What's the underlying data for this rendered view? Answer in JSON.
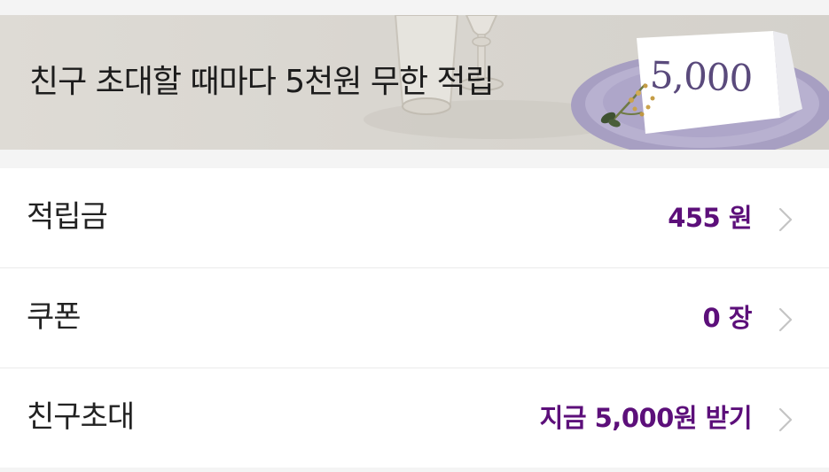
{
  "banner": {
    "title": "친구 초대할 때마다 5천원 무한 적립",
    "card_amount": "5,000"
  },
  "menu": {
    "items": [
      {
        "label": "적립금",
        "value": "455 원",
        "icon": "chevron-right-icon"
      },
      {
        "label": "쿠폰",
        "value": "0 장",
        "icon": "chevron-right-icon"
      },
      {
        "label": "친구초대",
        "value": "지금 5,000원 받기",
        "icon": "chevron-right-icon"
      }
    ]
  },
  "colors": {
    "accent": "#5c0f7a",
    "background": "#f4f4f4",
    "row_background": "#ffffff",
    "divider": "#ebebeb",
    "chevron": "#c4c4c4"
  }
}
